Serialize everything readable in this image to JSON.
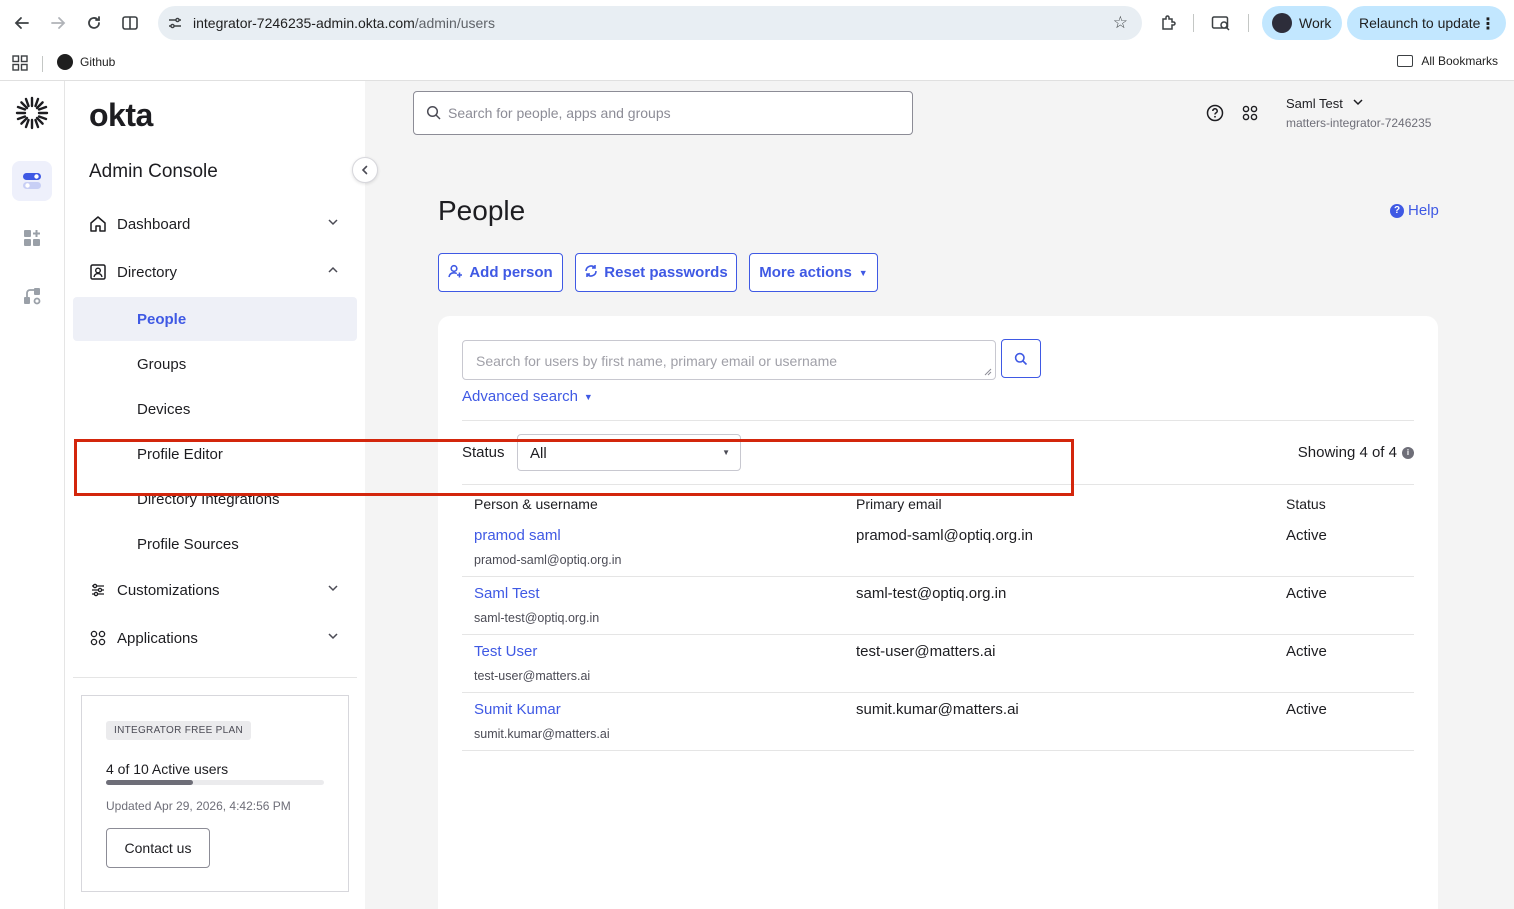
{
  "browser": {
    "url_host": "integrator-7246235-admin.okta.com",
    "url_path": "/admin/users",
    "profile_label": "Work",
    "relaunch_label": "Relaunch to update",
    "bookmarks": [
      {
        "label": "Github"
      }
    ],
    "all_bookmarks_label": "All Bookmarks"
  },
  "sidebar": {
    "brand": "okta",
    "console_title": "Admin Console",
    "sections": [
      {
        "label": "Dashboard",
        "expanded": false
      },
      {
        "label": "Directory",
        "expanded": true
      },
      {
        "label": "Customizations",
        "expanded": false
      },
      {
        "label": "Applications",
        "expanded": false
      }
    ],
    "directory_items": [
      {
        "label": "People",
        "active": true
      },
      {
        "label": "Groups"
      },
      {
        "label": "Devices"
      },
      {
        "label": "Profile Editor"
      },
      {
        "label": "Directory Integrations"
      },
      {
        "label": "Profile Sources"
      }
    ],
    "plan": {
      "badge": "INTEGRATOR FREE PLAN",
      "users_text": "4 of 10 Active users",
      "active_fraction": 0.4,
      "updated": "Updated Apr 29, 2026, 4:42:56 PM",
      "contact_label": "Contact us"
    }
  },
  "header": {
    "search_placeholder": "Search for people, apps and groups",
    "user_name": "Saml Test",
    "org_name": "matters-integrator-7246235"
  },
  "page": {
    "title": "People",
    "help_label": "Help",
    "actions": {
      "add_person": "Add person",
      "reset_passwords": "Reset passwords",
      "more_actions": "More actions"
    },
    "search_placeholder": "Search for users by first name, primary email or username",
    "advanced_search_label": "Advanced search",
    "status_label": "Status",
    "status_value": "All",
    "showing_text": "Showing 4 of 4",
    "columns": [
      "Person & username",
      "Primary email",
      "Status"
    ],
    "rows": [
      {
        "name": "pramod saml",
        "username": "pramod-saml@optiq.org.in",
        "email": "pramod-saml@optiq.org.in",
        "status": "Active"
      },
      {
        "name": "Saml Test",
        "username": "saml-test@optiq.org.in",
        "email": "saml-test@optiq.org.in",
        "status": "Active"
      },
      {
        "name": "Test User",
        "username": "test-user@matters.ai",
        "email": "test-user@matters.ai",
        "status": "Active"
      },
      {
        "name": "Sumit Kumar",
        "username": "sumit.kumar@matters.ai",
        "email": "sumit.kumar@matters.ai",
        "status": "Active"
      }
    ]
  },
  "colors": {
    "accent": "#3f59e4",
    "highlight": "#d3260c"
  }
}
